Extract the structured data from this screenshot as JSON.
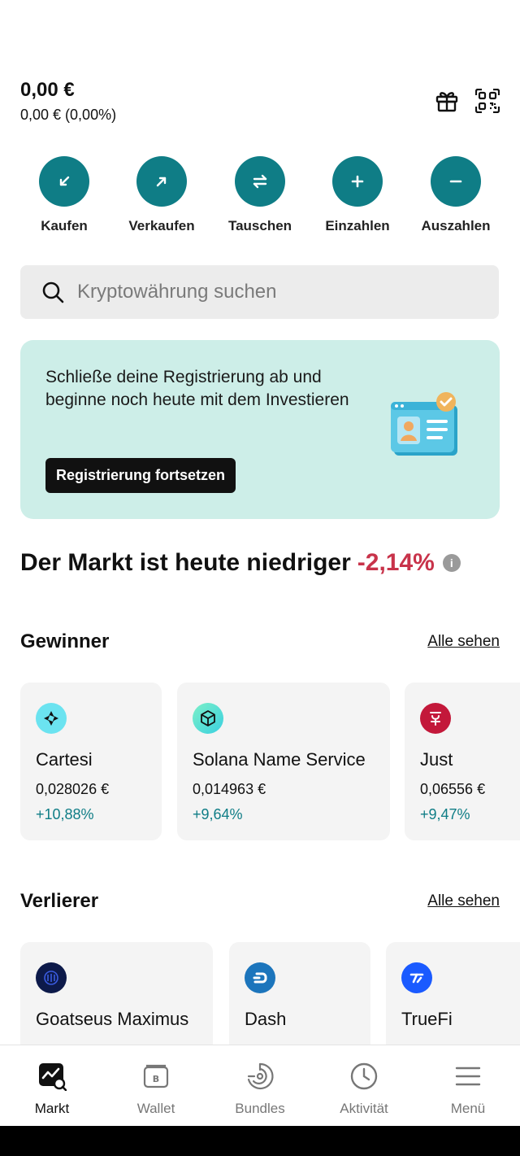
{
  "balance": {
    "amount": "0,00 €",
    "change": "0,00 € (0,00%)"
  },
  "top_icons": [
    "gift-icon",
    "qr-scan-icon"
  ],
  "actions": [
    {
      "label": "Kaufen",
      "icon": "arrow-down-left-icon"
    },
    {
      "label": "Verkaufen",
      "icon": "arrow-up-right-icon"
    },
    {
      "label": "Tauschen",
      "icon": "swap-icon"
    },
    {
      "label": "Einzahlen",
      "icon": "plus-icon"
    },
    {
      "label": "Auszahlen",
      "icon": "minus-icon"
    }
  ],
  "search": {
    "placeholder": "Kryptowährung suchen"
  },
  "promo": {
    "text": "Schließe deine Registrierung ab und beginne noch heute mit dem Investieren",
    "button": "Registrierung fortsetzen"
  },
  "market": {
    "headline": "Der Markt ist heute niedriger",
    "change": "-2,14%",
    "info": "i"
  },
  "gainers": {
    "title": "Gewinner",
    "see_all": "Alle sehen",
    "items": [
      {
        "name": "Cartesi",
        "price": "0,028026 €",
        "change": "+10,88%"
      },
      {
        "name": "Solana Name Service",
        "price": "0,014963 €",
        "change": "+9,64%"
      },
      {
        "name": "Just",
        "price": "0,06556 €",
        "change": "+9,47%"
      }
    ]
  },
  "losers": {
    "title": "Verlierer",
    "see_all": "Alle sehen",
    "items": [
      {
        "name": "Goatseus Maximus"
      },
      {
        "name": "Dash"
      },
      {
        "name": "TrueFi"
      }
    ]
  },
  "nav": [
    {
      "label": "Markt",
      "icon": "market-chart-icon"
    },
    {
      "label": "Wallet",
      "icon": "wallet-icon"
    },
    {
      "label": "Bundles",
      "icon": "bundles-icon"
    },
    {
      "label": "Aktivität",
      "icon": "clock-icon"
    },
    {
      "label": "Menü",
      "icon": "hamburger-menu-icon"
    }
  ],
  "colors": {
    "accent": "#0f7d86",
    "negative": "#c8334a",
    "promo_bg": "#cdeee8"
  }
}
